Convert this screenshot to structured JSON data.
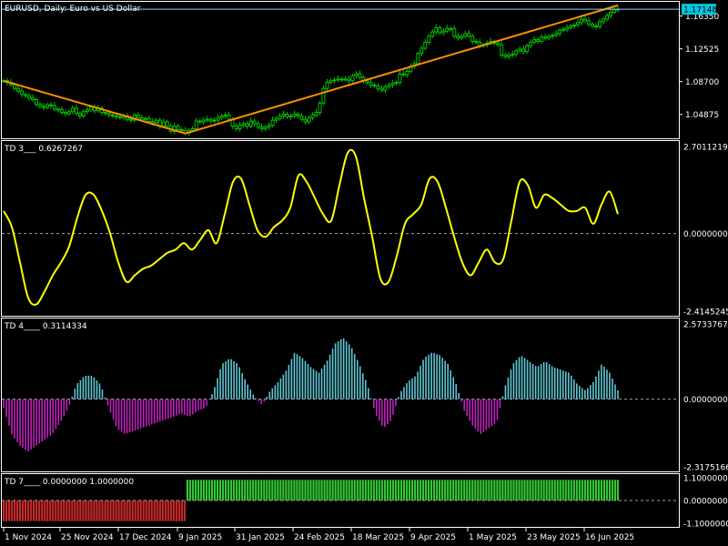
{
  "colors": {
    "background": "#000000",
    "frame": "#ffffff",
    "candle": "#00c000",
    "trendline": "#ff9000",
    "level_line": "#87cefa",
    "td3_line": "#ffff00",
    "td4_positive": "#5fc8d6",
    "td4_negative": "#c020c0",
    "td7_up": "#32c832",
    "td7_down": "#c82828",
    "zero_line": "#9aa5a5",
    "text": "#ffffff",
    "price_tag_bg": "#00c8e0",
    "price_tag_text": "#000000"
  },
  "main_panel": {
    "title": "EURUSD, Daily:  Euro vs US Dollar",
    "current_price": "1.17148",
    "scale_labels": [
      "1.16350",
      "1.12525",
      "1.08700",
      "1.04875"
    ]
  },
  "td3": {
    "label": "TD 3___ 0.6267267",
    "scale_labels": [
      "2.7011219",
      "0.0000000",
      "-2.4145245"
    ]
  },
  "td4": {
    "label": "TD 4____ 0.3114334",
    "scale_labels": [
      "2.5733767",
      "0.0000000",
      "-2.3175166"
    ]
  },
  "td7": {
    "label": "TD 7____ 0.0000000 1.0000000",
    "scale_labels": [
      "1.1000000",
      "0.0000000",
      "-1.1000000"
    ]
  },
  "x_axis": {
    "labels": [
      "1 Nov 2024",
      "25 Nov 2024",
      "17 Dec 2024",
      "9 Jan 2025",
      "31 Jan 2025",
      "24 Feb 2025",
      "18 Mar 2025",
      "9 Apr 2025",
      "1 May 2025",
      "23 May 2025",
      "16 Jun 2025"
    ]
  },
  "chart_data": [
    {
      "type": "candlestick",
      "title": "EURUSD, Daily:  Euro vs US Dollar",
      "ylim": [
        1.023,
        1.178
      ],
      "close_series": [
        1.088,
        1.086,
        1.0835,
        1.079,
        1.076,
        1.072,
        1.0705,
        1.068,
        1.066,
        1.0605,
        1.058,
        1.057,
        1.06,
        1.059,
        1.055,
        1.0545,
        1.051,
        1.0495,
        1.052,
        1.056,
        1.05,
        1.047,
        1.052,
        1.054,
        1.0575,
        1.053,
        1.056,
        1.051,
        1.05,
        1.048,
        1.047,
        1.046,
        1.045,
        1.047,
        1.043,
        1.042,
        1.048,
        1.045,
        1.043,
        1.044,
        1.0405,
        1.039,
        1.042,
        1.035,
        1.04,
        1.035,
        1.029,
        1.035,
        1.031,
        1.03,
        1.027,
        1.03,
        1.032,
        1.041,
        1.04,
        1.042,
        1.043,
        1.041,
        1.042,
        1.045,
        1.047,
        1.048,
        1.043,
        1.035,
        1.032,
        1.036,
        1.038,
        1.035,
        1.041,
        1.038,
        1.034,
        1.032,
        1.034,
        1.036,
        1.042,
        1.044,
        1.047,
        1.049,
        1.046,
        1.047,
        1.049,
        1.047,
        1.043,
        1.04,
        1.045,
        1.048,
        1.051,
        1.062,
        1.079,
        1.086,
        1.088,
        1.089,
        1.09,
        1.09,
        1.09,
        1.088,
        1.094,
        1.096,
        1.092,
        1.088,
        1.086,
        1.083,
        1.082,
        1.079,
        1.077,
        1.081,
        1.083,
        1.085,
        1.086,
        1.096,
        1.095,
        1.099,
        1.105,
        1.108,
        1.12,
        1.126,
        1.133,
        1.14,
        1.145,
        1.15,
        1.144,
        1.146,
        1.149,
        1.149,
        1.14,
        1.138,
        1.14,
        1.143,
        1.14,
        1.134,
        1.133,
        1.129,
        1.13,
        1.132,
        1.134,
        1.132,
        1.13,
        1.118,
        1.116,
        1.118,
        1.119,
        1.123,
        1.125,
        1.122,
        1.129,
        1.133,
        1.136,
        1.134,
        1.139,
        1.138,
        1.14,
        1.141,
        1.143,
        1.147,
        1.148,
        1.15,
        1.152,
        1.153,
        1.156,
        1.16,
        1.158,
        1.154,
        1.152,
        1.151,
        1.157,
        1.16,
        1.164,
        1.168,
        1.171,
        1.1715
      ]
    },
    {
      "type": "line",
      "name": "TD 3",
      "ylim": [
        -2.4145245,
        2.7011219
      ],
      "values": [
        0.7,
        0.2,
        -0.9,
        -2.0,
        -2.2,
        -1.8,
        -1.3,
        -0.9,
        -0.4,
        0.5,
        1.2,
        1.2,
        0.7,
        0.0,
        -0.9,
        -1.5,
        -1.3,
        -1.1,
        -1.0,
        -0.8,
        -0.6,
        -0.5,
        -0.3,
        -0.5,
        -0.2,
        0.1,
        -0.3,
        0.6,
        1.6,
        1.7,
        0.9,
        0.1,
        -0.1,
        0.2,
        0.4,
        0.8,
        1.8,
        1.6,
        1.1,
        0.6,
        0.4,
        1.5,
        2.5,
        2.4,
        1.1,
        -0.1,
        -1.4,
        -1.5,
        -0.7,
        0.3,
        0.6,
        0.9,
        1.7,
        1.6,
        0.8,
        -0.1,
        -0.9,
        -1.3,
        -0.9,
        -0.5,
        -0.9,
        -0.8,
        0.4,
        1.6,
        1.5,
        0.8,
        1.2,
        1.1,
        0.9,
        0.7,
        0.7,
        0.8,
        0.3,
        0.9,
        1.3,
        0.6
      ]
    },
    {
      "type": "bar",
      "name": "TD 4",
      "ylim": [
        -2.3175166,
        2.5733767
      ],
      "values": [
        -0.3,
        -1.2,
        -1.6,
        -1.8,
        -1.6,
        -1.4,
        -1.2,
        -0.8,
        -0.3,
        0.5,
        0.8,
        0.8,
        0.5,
        -0.3,
        -1.0,
        -1.2,
        -1.1,
        -1.0,
        -0.9,
        -0.8,
        -0.7,
        -0.6,
        -0.5,
        -0.6,
        -0.4,
        -0.3,
        0.3,
        1.2,
        1.4,
        1.2,
        0.6,
        0.1,
        -0.2,
        0.3,
        0.6,
        1.0,
        1.6,
        1.4,
        1.1,
        0.9,
        1.3,
        1.9,
        2.1,
        1.8,
        1.2,
        0.5,
        -0.5,
        -1.0,
        -0.7,
        0.2,
        0.6,
        0.8,
        1.4,
        1.6,
        1.5,
        1.2,
        0.5,
        -0.4,
        -0.9,
        -1.2,
        -1.0,
        -0.8,
        0.4,
        1.2,
        1.5,
        1.3,
        1.1,
        1.3,
        1.1,
        1.0,
        0.9,
        0.5,
        0.3,
        0.6,
        1.2,
        0.9,
        0.3
      ]
    },
    {
      "type": "bar",
      "name": "TD 7",
      "ylim": [
        -1.1,
        1.1
      ],
      "switch_date": "9 Jan 2025",
      "values": [
        -1,
        1
      ]
    }
  ]
}
